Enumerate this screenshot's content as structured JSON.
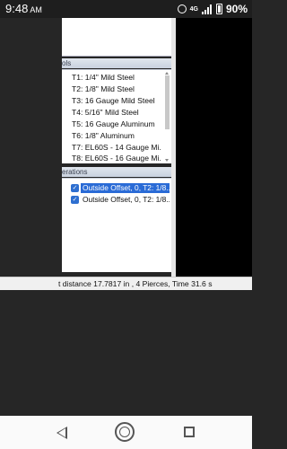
{
  "statusbar": {
    "time": "9:48",
    "ampm": "AM",
    "network": "4G",
    "battery": "90%"
  },
  "tools_panel": {
    "header": "ols",
    "items": [
      "T1: 1/4\" Mild Steel",
      "T2: 1/8\" Mild Steel",
      "T3: 16 Gauge Mild Steel",
      "T4: 5/16\" Mild Steel",
      "T5: 16 Gauge Aluminum",
      "T6: 1/8\" Aluminum",
      "T7: EL60S - 14 Gauge Mi...",
      "T8: EL60S - 16 Gauge Mi..."
    ]
  },
  "operations_panel": {
    "header": "erations",
    "items": [
      {
        "text": "Outside Offset, 0, T2: 1/8...",
        "selected": true
      },
      {
        "text": "Outside Offset, 0, T2: 1/8...",
        "selected": false
      }
    ]
  },
  "status_line": "t distance 17.7817 in , 4 Pierces, Time 31.6 s"
}
